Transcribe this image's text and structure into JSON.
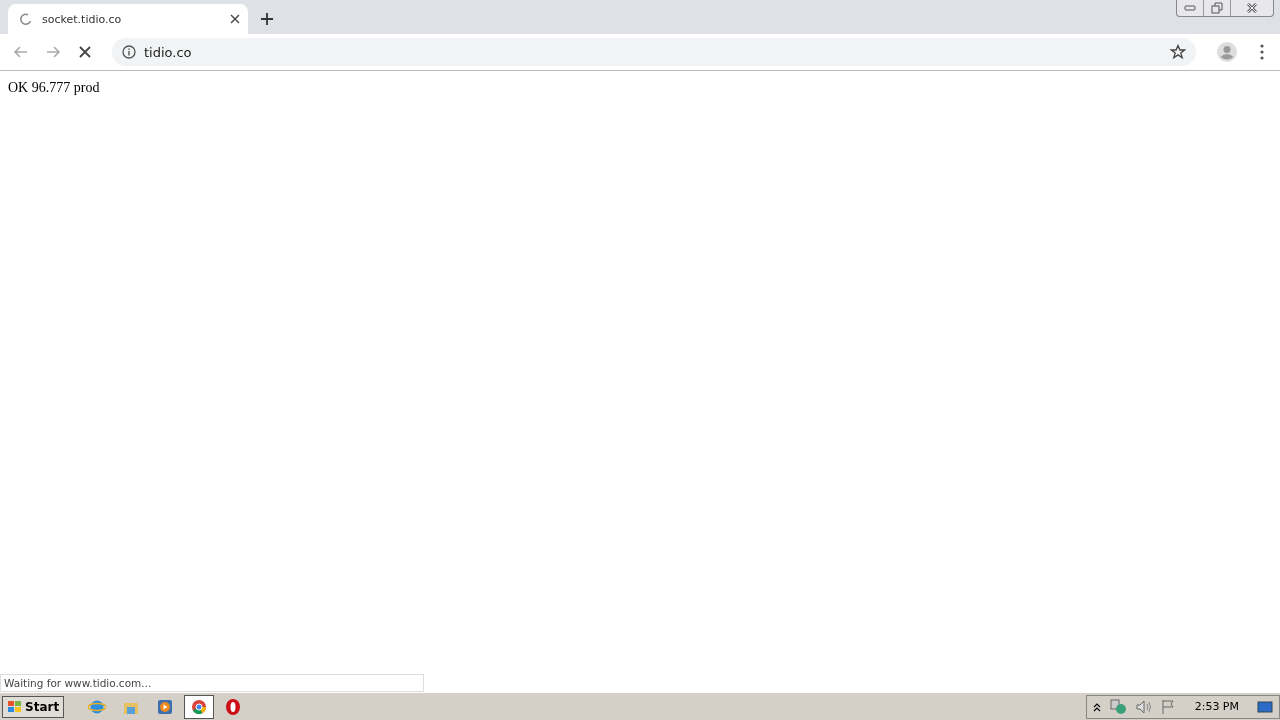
{
  "tab": {
    "title": "socket.tidio.co",
    "loading": true
  },
  "address": {
    "value": "tidio.co"
  },
  "page": {
    "text": "OK 96.777 prod"
  },
  "status_bar": {
    "text": "Waiting for www.tidio.com..."
  },
  "taskbar": {
    "start": "Start",
    "apps": [
      {
        "kind": "ie",
        "selected": false
      },
      {
        "kind": "explorer",
        "selected": false
      },
      {
        "kind": "media",
        "selected": false
      },
      {
        "kind": "chrome",
        "selected": true
      },
      {
        "kind": "opera",
        "selected": false
      }
    ],
    "clock": "2:53 PM"
  }
}
